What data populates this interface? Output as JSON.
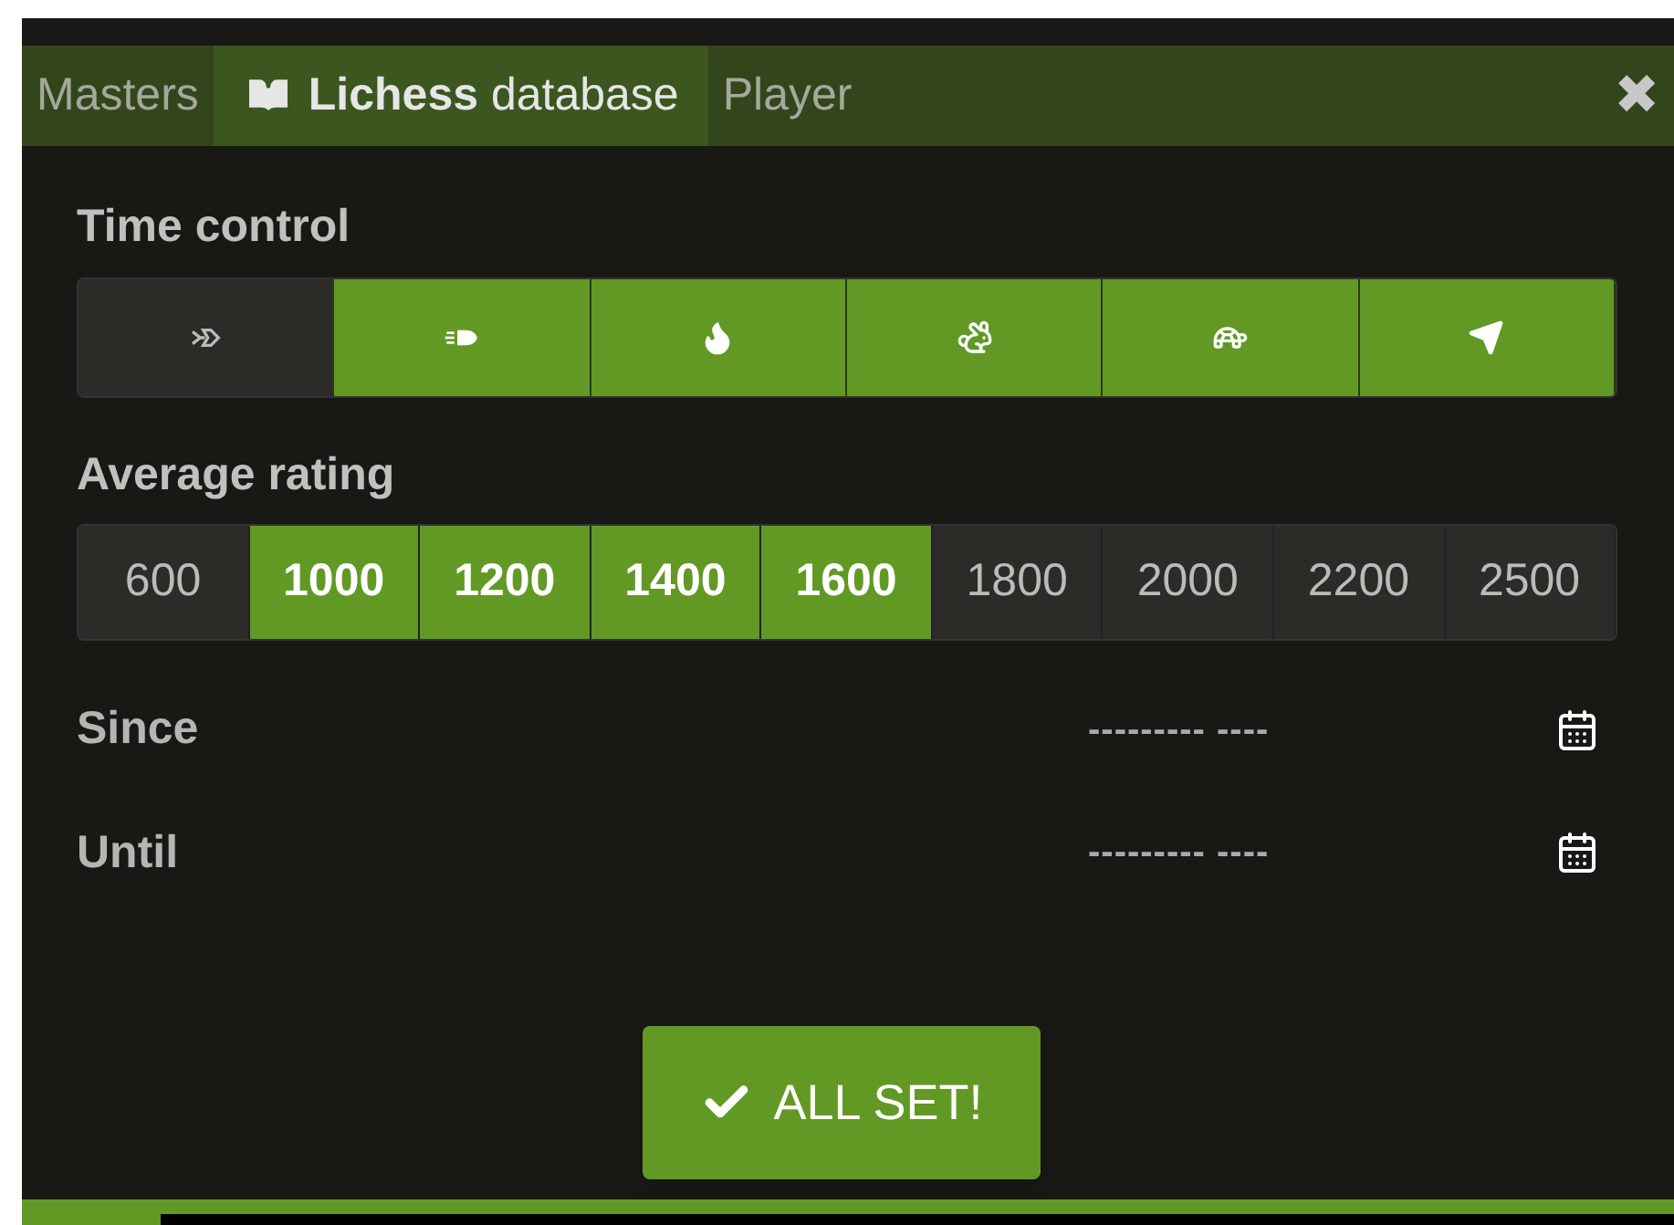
{
  "tabs": [
    {
      "label": "Masters",
      "selected": false,
      "icon": false
    },
    {
      "label": "**Lichess** database",
      "selected": true,
      "icon": true
    },
    {
      "label": "Player",
      "selected": false,
      "icon": false
    }
  ],
  "close": "✖",
  "time_control": {
    "title": "Time control",
    "options": [
      {
        "kind": "ultrabullet",
        "selected": false
      },
      {
        "kind": "bullet",
        "selected": true
      },
      {
        "kind": "blitz",
        "selected": true
      },
      {
        "kind": "rapid",
        "selected": true
      },
      {
        "kind": "classical",
        "selected": true
      },
      {
        "kind": "correspondence",
        "selected": true
      }
    ]
  },
  "average_rating": {
    "title": "Average rating",
    "options": [
      {
        "label": "600",
        "selected": false
      },
      {
        "label": "1000",
        "selected": true
      },
      {
        "label": "1200",
        "selected": true
      },
      {
        "label": "1400",
        "selected": true
      },
      {
        "label": "1600",
        "selected": true
      },
      {
        "label": "1800",
        "selected": false
      },
      {
        "label": "2000",
        "selected": false
      },
      {
        "label": "2200",
        "selected": false
      },
      {
        "label": "2500",
        "selected": false
      }
    ]
  },
  "dates": [
    {
      "label": "Since",
      "value": "--------- ----"
    },
    {
      "label": "Until",
      "value": "--------- ----"
    }
  ],
  "submit": "ALL SET!"
}
